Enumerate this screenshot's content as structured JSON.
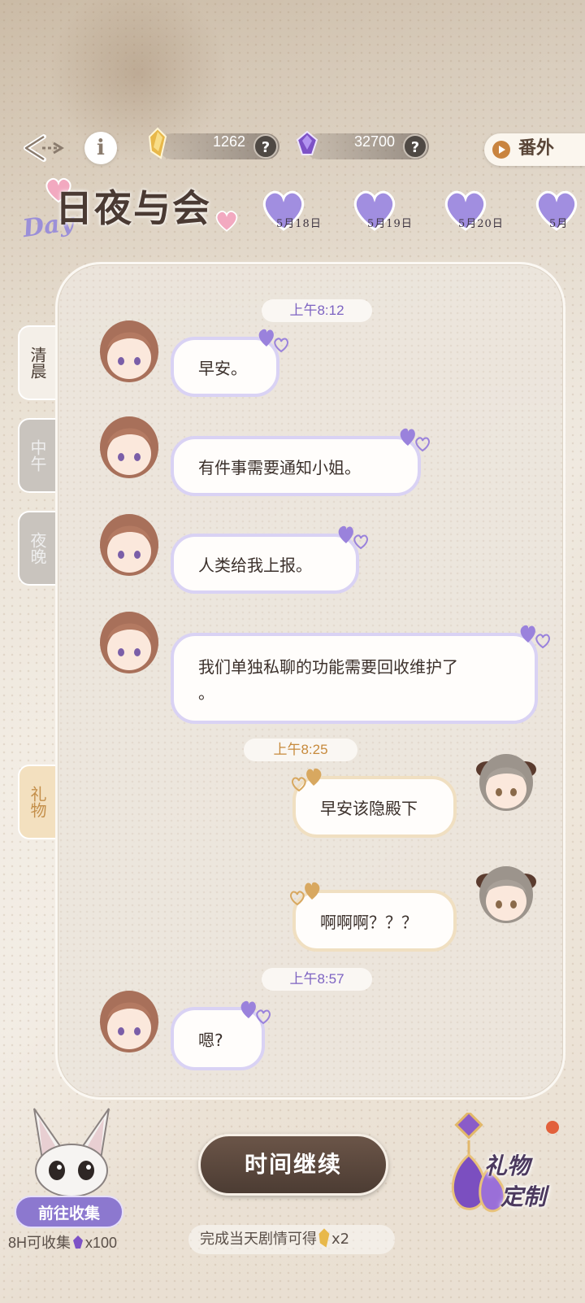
{
  "header": {
    "gold_value": "1262",
    "gem_value": "32700",
    "help_mark": "?",
    "info_glyph": "i",
    "extra_label": "番外"
  },
  "title": {
    "day_word": "Day",
    "main": "日夜与会"
  },
  "dates": [
    "5月18日",
    "5月19日",
    "5月20日",
    "5月"
  ],
  "tabs": {
    "morning": "清晨",
    "noon": "中午",
    "night": "夜晚",
    "gift": "礼物"
  },
  "chat": {
    "time1": "上午8:12",
    "msg1": "早安。",
    "msg2": "有件事需要通知小姐。",
    "msg3": "人类给我上报。",
    "msg4_line1": "我们单独私聊的功能需要回收维护了",
    "msg4_line2": "。",
    "time2": "上午8:25",
    "msg5": "早安该隐殿下",
    "msg6": "啊啊啊？？？",
    "time3": "上午8:57",
    "msg7": "嗯?"
  },
  "bottom": {
    "continue_label": "时间继续",
    "collect_label": "前往收集",
    "collect_note_prefix": "8H可收集",
    "collect_note_suffix": "x100",
    "reward_prefix": "完成当天剧情可得",
    "reward_suffix": "x2",
    "custom_line1": "礼物",
    "custom_line2": "定制"
  },
  "colors": {
    "accent_purple": "#8c78cf",
    "bubble_left_border": "#d9d2f4",
    "bubble_right_border": "#f0dfc1",
    "continue_button": "#5a463b"
  }
}
